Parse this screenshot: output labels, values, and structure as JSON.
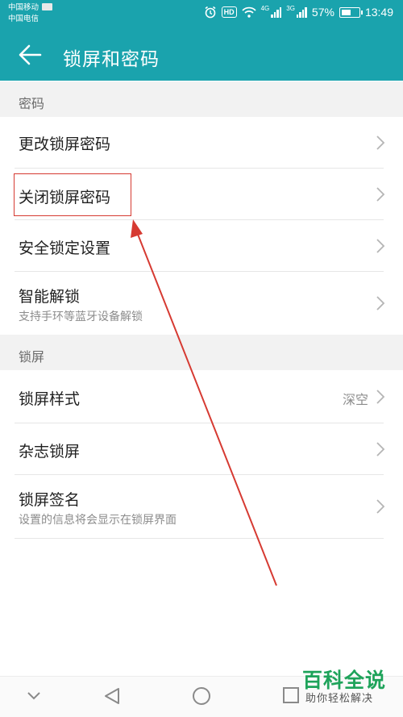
{
  "status_bar": {
    "carrier_1": "中国移动",
    "carrier_2": "中国电信",
    "network_1": "4G",
    "network_2": "3G",
    "battery": "57%",
    "time": "13:49",
    "icons": [
      "sim-icon",
      "alarm-icon",
      "hd-icon",
      "wifi-icon",
      "signal-icon",
      "battery-icon"
    ]
  },
  "app_bar": {
    "title": "锁屏和密码",
    "back_icon": "arrow-left-icon"
  },
  "sections": [
    {
      "header": "密码",
      "items": [
        {
          "label": "更改锁屏密码"
        },
        {
          "label": "关闭锁屏密码",
          "highlighted": true
        },
        {
          "label": "安全锁定设置"
        },
        {
          "label": "智能解锁",
          "subtitle": "支持手环等蓝牙设备解锁"
        }
      ]
    },
    {
      "header": "锁屏",
      "items": [
        {
          "label": "锁屏样式",
          "value": "深空"
        },
        {
          "label": "杂志锁屏"
        },
        {
          "label": "锁屏签名",
          "subtitle": "设置的信息将会显示在锁屏界面"
        }
      ]
    }
  ],
  "nav_bar": {
    "icons": [
      "chevron-down-icon",
      "back-triangle-icon",
      "home-circle-icon",
      "recents-square-icon"
    ]
  },
  "watermark": {
    "title": "百科全说",
    "subtitle": "助你轻松解决"
  },
  "colors": {
    "header": "#1aa3ad",
    "section_bg": "#f2f2f2",
    "annotation": "#d63a32",
    "watermark": "#1ea35a"
  }
}
